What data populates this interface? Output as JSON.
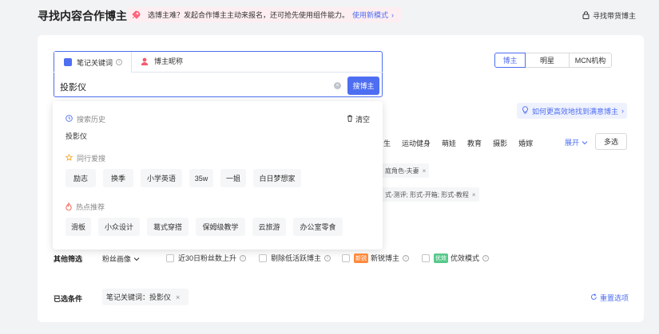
{
  "page_title": "寻找内容合作博主",
  "banner": {
    "text": "选博主难？发起合作博主主动来报名，还可抢先使用组件能力。",
    "link": "使用新模式",
    "chevron": "›"
  },
  "top_link": "寻找带货博主",
  "search": {
    "tab_keyword": "笔记关键词",
    "tab_nickname": "博主昵称",
    "query": "投影仪",
    "clear_glyph": "×",
    "button": "搜博主"
  },
  "segmented": [
    "博主",
    "明星",
    "MCN机构"
  ],
  "tip": "如何更高效地找到满意博主",
  "tip_chevron": "›",
  "categories": [
    "生",
    "运动健身",
    "萌娃",
    "教育",
    "摄影",
    "婚嫁"
  ],
  "expand": "展开",
  "multi_select": "多选",
  "filter_tags": [
    "庭角色-夫妻",
    "式-测评; 形式-开箱; 形式-教程"
  ],
  "dropdown": {
    "history_title": "搜索历史",
    "clear_all": "清空",
    "history_items": [
      "投影仪"
    ],
    "peer_title": "同行爱搜",
    "peer_items": [
      "励志",
      "换季",
      "小学英语",
      "35w",
      "一姐",
      "白日梦想家"
    ],
    "hot_title": "热点推荐",
    "hot_items": [
      "滑板",
      "小众设计",
      "葛式穿搭",
      "保姆级教学",
      "云旅游",
      "办公室零食"
    ]
  },
  "other_filters": {
    "label": "其他筛选",
    "fans_profile": "粉丝画像",
    "opt_30d": "近30日粉丝数上升",
    "opt_low_active": "剔除低活跃博主",
    "badge_new": "新锐",
    "opt_new": "新锐博主",
    "badge_good": "优效",
    "opt_good": "优效模式"
  },
  "selected": {
    "label": "已选条件",
    "chip": "笔记关键词：投影仪",
    "remove": "×",
    "reset": "重置选项"
  },
  "colors": {
    "accent": "#4e6ef2",
    "banner_bg": "#fdeef1",
    "badge_new": "#ff8a3d",
    "badge_good": "#58c98b"
  }
}
